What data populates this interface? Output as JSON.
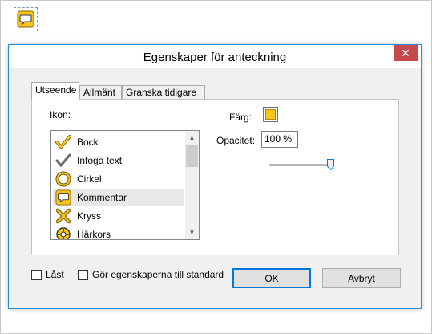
{
  "desktop": {
    "icon": "comment-icon"
  },
  "dialog": {
    "title": "Egenskaper för anteckning",
    "close_label": "✕",
    "tabs": [
      {
        "label": "Utseende",
        "active": true
      },
      {
        "label": "Allmänt",
        "active": false
      },
      {
        "label": "Granska tidigare",
        "active": false
      }
    ],
    "appearance": {
      "icon_label": "Ikon:",
      "icon_list": [
        {
          "label": "Bock",
          "icon": "checkmark-yellow-icon"
        },
        {
          "label": "Infoga text",
          "icon": "checkmark-gray-icon"
        },
        {
          "label": "Cirkel",
          "icon": "circle-icon"
        },
        {
          "label": "Kommentar",
          "icon": "comment-icon",
          "selected": true
        },
        {
          "label": "Kryss",
          "icon": "cross-icon"
        },
        {
          "label": "Hårkors",
          "icon": "crosshair-icon"
        }
      ],
      "color_label": "Färg:",
      "color_value": "#f7c41a",
      "opacity_label": "Opacitet:",
      "opacity_value": "100 %",
      "opacity_slider_fraction": 1.0
    },
    "footer": {
      "locked_label": "Låst",
      "locked_checked": false,
      "default_label": "Gör egenskaperna till standard",
      "default_checked": false,
      "ok_label": "OK",
      "cancel_label": "Avbryt"
    }
  }
}
